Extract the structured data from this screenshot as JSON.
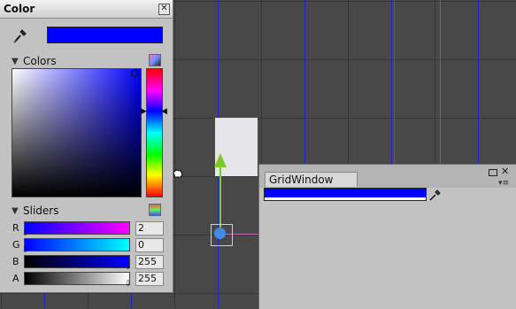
{
  "color_window": {
    "title": "Color",
    "close_glyph": "✕",
    "current_color": "#0000ff",
    "colors_section": {
      "label": "Colors",
      "triangle": "▼"
    },
    "sliders_section": {
      "label": "Sliders",
      "triangle": "▼"
    },
    "sliders": [
      {
        "label": "R",
        "value": "2"
      },
      {
        "label": "G",
        "value": "0"
      },
      {
        "label": "B",
        "value": "255"
      },
      {
        "label": "A",
        "value": "255"
      }
    ]
  },
  "grid_window": {
    "tab_label": "GridWindow",
    "close_glyph": "✕",
    "menu_glyph": "▾≡",
    "field_color": "#0000ff"
  },
  "scene": {
    "grid_color": "#2323c8",
    "background": "#484848"
  }
}
